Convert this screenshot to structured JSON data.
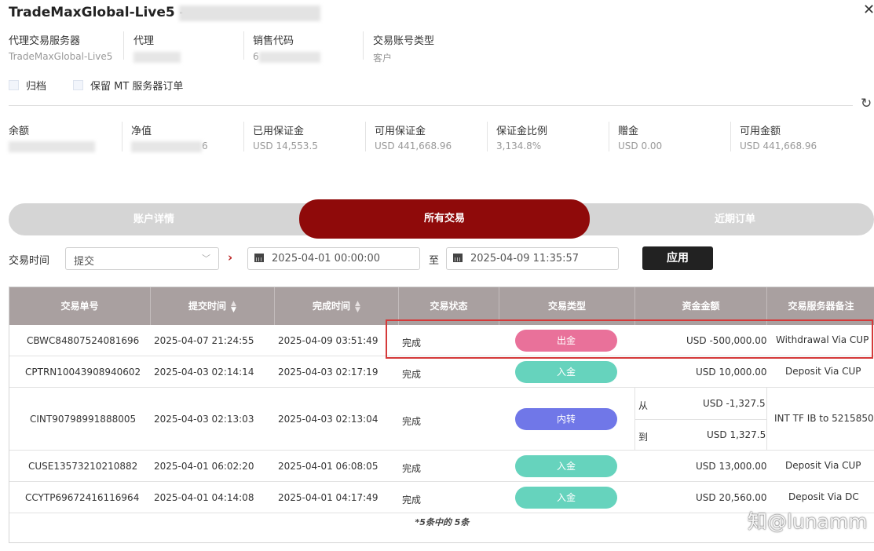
{
  "header": {
    "title": "TradeMaxGlobal-Live5 -",
    "close_icon": "close-icon"
  },
  "info": [
    {
      "label": "代理交易服务器",
      "value": "TradeMaxGlobal-Live5"
    },
    {
      "label": "代理",
      "value": ""
    },
    {
      "label": "销售代码",
      "value": "6"
    },
    {
      "label": "交易账号类型",
      "value": "客户"
    }
  ],
  "checkboxes": [
    {
      "label": "归档",
      "checked": false
    },
    {
      "label": "保留 MT 服务器订单",
      "checked": false
    }
  ],
  "stats": [
    {
      "label": "余额",
      "value": ""
    },
    {
      "label": "净值",
      "value": "6"
    },
    {
      "label": "已用保证金",
      "value": "USD 14,553.5"
    },
    {
      "label": "可用保证金",
      "value": "USD 441,668.96"
    },
    {
      "label": "保证金比例",
      "value": "3,134.8%"
    },
    {
      "label": "赠金",
      "value": "USD 0.00"
    },
    {
      "label": "可用金额",
      "value": "USD 441,668.96"
    }
  ],
  "tabs": [
    {
      "label": "账户详情",
      "active": false
    },
    {
      "label": "所有交易",
      "active": true
    },
    {
      "label": "近期订单",
      "active": false
    }
  ],
  "filter": {
    "label": "交易时间",
    "select_value": "提交",
    "date_from": "2025-04-01 00:00:00",
    "separator": "至",
    "date_to": "2025-04-09 11:35:57",
    "apply_label": "应用"
  },
  "table": {
    "headers": [
      "交易单号",
      "提交时间",
      "完成时间",
      "交易状态",
      "交易类型",
      "资金金额",
      "交易服务器备注"
    ],
    "rows": [
      {
        "id": "CBWC84807524081696",
        "submit": "2025-04-07 21:24:55",
        "complete": "2025-04-09 03:51:49",
        "status": "完成",
        "type": "出金",
        "type_color": "#e9719a",
        "amount": "USD -500,000.00",
        "note": "Withdrawal Via CUP"
      },
      {
        "id": "CPTRN10043908940602",
        "submit": "2025-04-03 02:14:14",
        "complete": "2025-04-03 02:17:19",
        "status": "完成",
        "type": "入金",
        "type_color": "#66d3bd",
        "amount": "USD 10,000.00",
        "note": "Deposit Via CUP"
      },
      {
        "id": "CINT90798991888005",
        "submit": "2025-04-03 02:13:03",
        "complete": "2025-04-03 02:13:04",
        "status": "完成",
        "type": "内转",
        "type_color": "#7077e8",
        "from_label": "从",
        "from_amount": "USD -1,327.5",
        "to_label": "到",
        "to_amount": "USD 1,327.5",
        "note": "INT TF IB to 5215850"
      },
      {
        "id": "CUSE13573210210882",
        "submit": "2025-04-01 06:02:20",
        "complete": "2025-04-01 06:08:05",
        "status": "完成",
        "type": "入金",
        "type_color": "#66d3bd",
        "amount": "USD 13,000.00",
        "note": "Deposit Via CUP"
      },
      {
        "id": "CCYTP69672416116964",
        "submit": "2025-04-01 04:14:08",
        "complete": "2025-04-01 04:17:49",
        "status": "完成",
        "type": "入金",
        "type_color": "#66d3bd",
        "amount": "USD 20,560.00",
        "note": "Deposit Via DC"
      }
    ],
    "footer": "*5条中的 5条"
  },
  "watermark": "知@lunamm"
}
